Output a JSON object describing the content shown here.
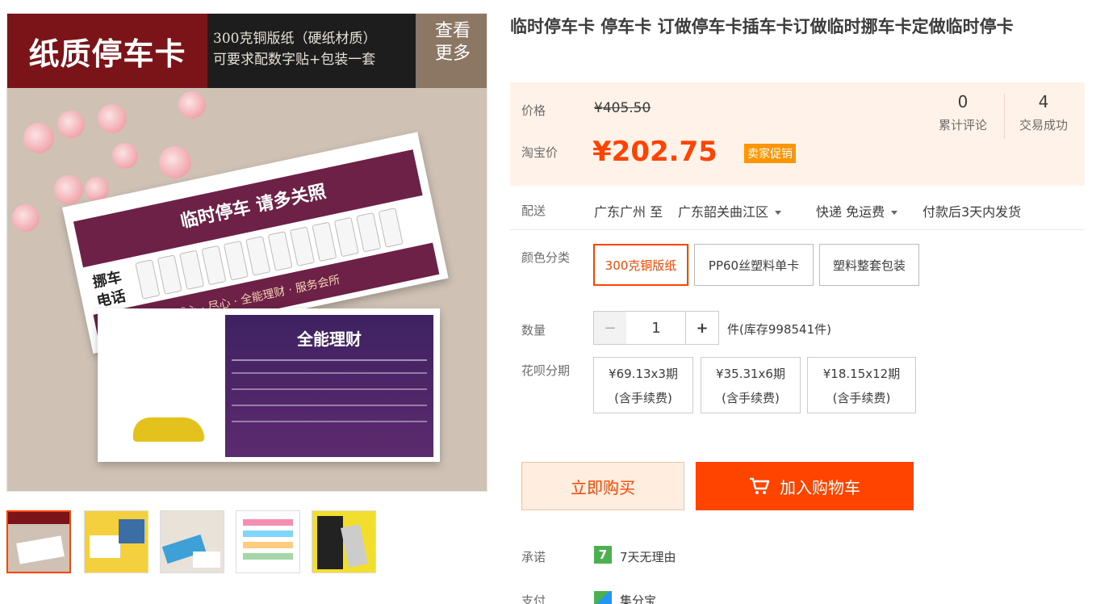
{
  "banner": {
    "main": "纸质停车卡",
    "sub_line1": "300克铜版纸（硬纸材质）",
    "sub_line2": "可要求配数字贴+包装一套",
    "more_line1": "查看",
    "more_line2": "更多"
  },
  "card_front": {
    "title": "临时停车 请多关照",
    "side_label_line1": "挪车",
    "side_label_line2": "电话",
    "bottom_text": "诚心 · 尽心 · 全能理财 · 服务会所"
  },
  "card_back": {
    "title": "全能理财"
  },
  "product": {
    "title": "临时停车卡 停车卡 订做停车卡插车卡订做临时挪车卡定做临时停卡"
  },
  "price": {
    "label_price": "价格",
    "original": "¥405.50",
    "label_taobao": "淘宝价",
    "current": "¥202.75",
    "promo_tag": "卖家促销"
  },
  "stats": {
    "reviews_count": "0",
    "reviews_label": "累计评论",
    "trades_count": "4",
    "trades_label": "交易成功"
  },
  "delivery": {
    "label": "配送",
    "from": "广东广州 至",
    "to": "广东韶关曲江区",
    "shipping": "快递 免运费",
    "dispatch": "付款后3天内发货"
  },
  "color": {
    "label": "颜色分类",
    "options": [
      "300克铜版纸",
      "PP60丝塑料单卡",
      "塑料整套包装"
    ],
    "selected": 0
  },
  "quantity": {
    "label": "数量",
    "minus": "−",
    "value": "1",
    "plus": "+",
    "stock": "件(库存998541件)"
  },
  "installment": {
    "label": "花呗分期",
    "options": [
      {
        "amount": "¥69.13x3期",
        "note": "(含手续费)"
      },
      {
        "amount": "¥35.31x6期",
        "note": "(含手续费)"
      },
      {
        "amount": "¥18.15x12期",
        "note": "(含手续费)"
      }
    ]
  },
  "actions": {
    "buy_now": "立即购买",
    "add_cart": "加入购物车"
  },
  "promise": {
    "label": "承诺",
    "badge": "7",
    "text": "7天无理由"
  },
  "payment": {
    "label": "支付",
    "text": "集分宝"
  },
  "colors": {
    "accent": "#ff4400",
    "price_bg": "#fff2e8",
    "banner_red": "#7b1418",
    "card_purple": "#6d2147"
  }
}
